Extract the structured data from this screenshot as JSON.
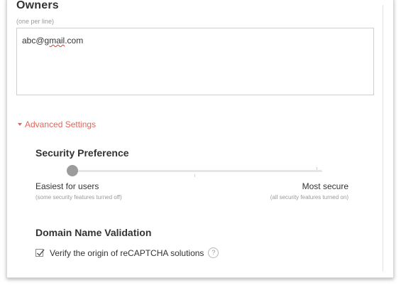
{
  "owners": {
    "title": "Owners",
    "hint": "(one per line)",
    "value_prefix": "abc@",
    "value_misspelled": "gmail",
    "value_suffix": ".com"
  },
  "advanced": {
    "label": "Advanced Settings",
    "expanded": true,
    "accent_color": "#e46458"
  },
  "security": {
    "title": "Security Preference",
    "slider_value": 0,
    "left_label": "Easiest for users",
    "left_sub": "(some security features turned off)",
    "right_label": "Most secure",
    "right_sub": "(all security features turned on)"
  },
  "domain_validation": {
    "title": "Domain Name Validation",
    "checkbox_label": "Verify the origin of reCAPTCHA solutions",
    "checked": true,
    "help_glyph": "?",
    "help_icon": "question-circle-icon"
  }
}
